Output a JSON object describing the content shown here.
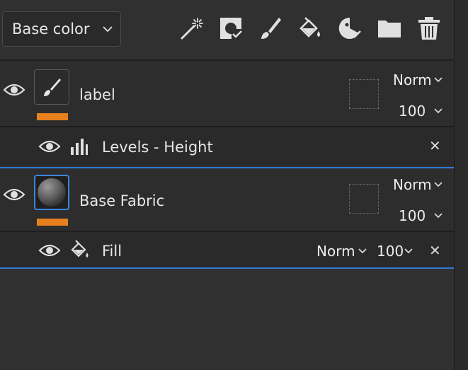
{
  "toolbar": {
    "channel": "Base color",
    "tools": [
      {
        "name": "magic-wand-icon"
      },
      {
        "name": "smart-material-icon"
      },
      {
        "name": "paint-brush-icon"
      },
      {
        "name": "fill-bucket-icon"
      },
      {
        "name": "smart-mask-icon"
      },
      {
        "name": "folder-icon"
      },
      {
        "name": "trash-icon"
      }
    ]
  },
  "layers": [
    {
      "name": "label",
      "blend_mode": "Norm",
      "opacity": "100",
      "thumbnail": "paint-brush",
      "selected": false,
      "effects": [
        {
          "name": "Levels - Height",
          "icon": "levels-icon"
        }
      ]
    },
    {
      "name": "Base Fabric",
      "blend_mode": "Norm",
      "opacity": "100",
      "thumbnail": "sphere",
      "selected": true,
      "effects": [
        {
          "name": "Fill",
          "icon": "fill-bucket-icon",
          "blend_mode": "Norm",
          "opacity": "100"
        }
      ]
    }
  ],
  "colors": {
    "accent_orange": "#e8801e",
    "selection_blue": "#2f7ad6",
    "panel_bg": "#303030"
  }
}
